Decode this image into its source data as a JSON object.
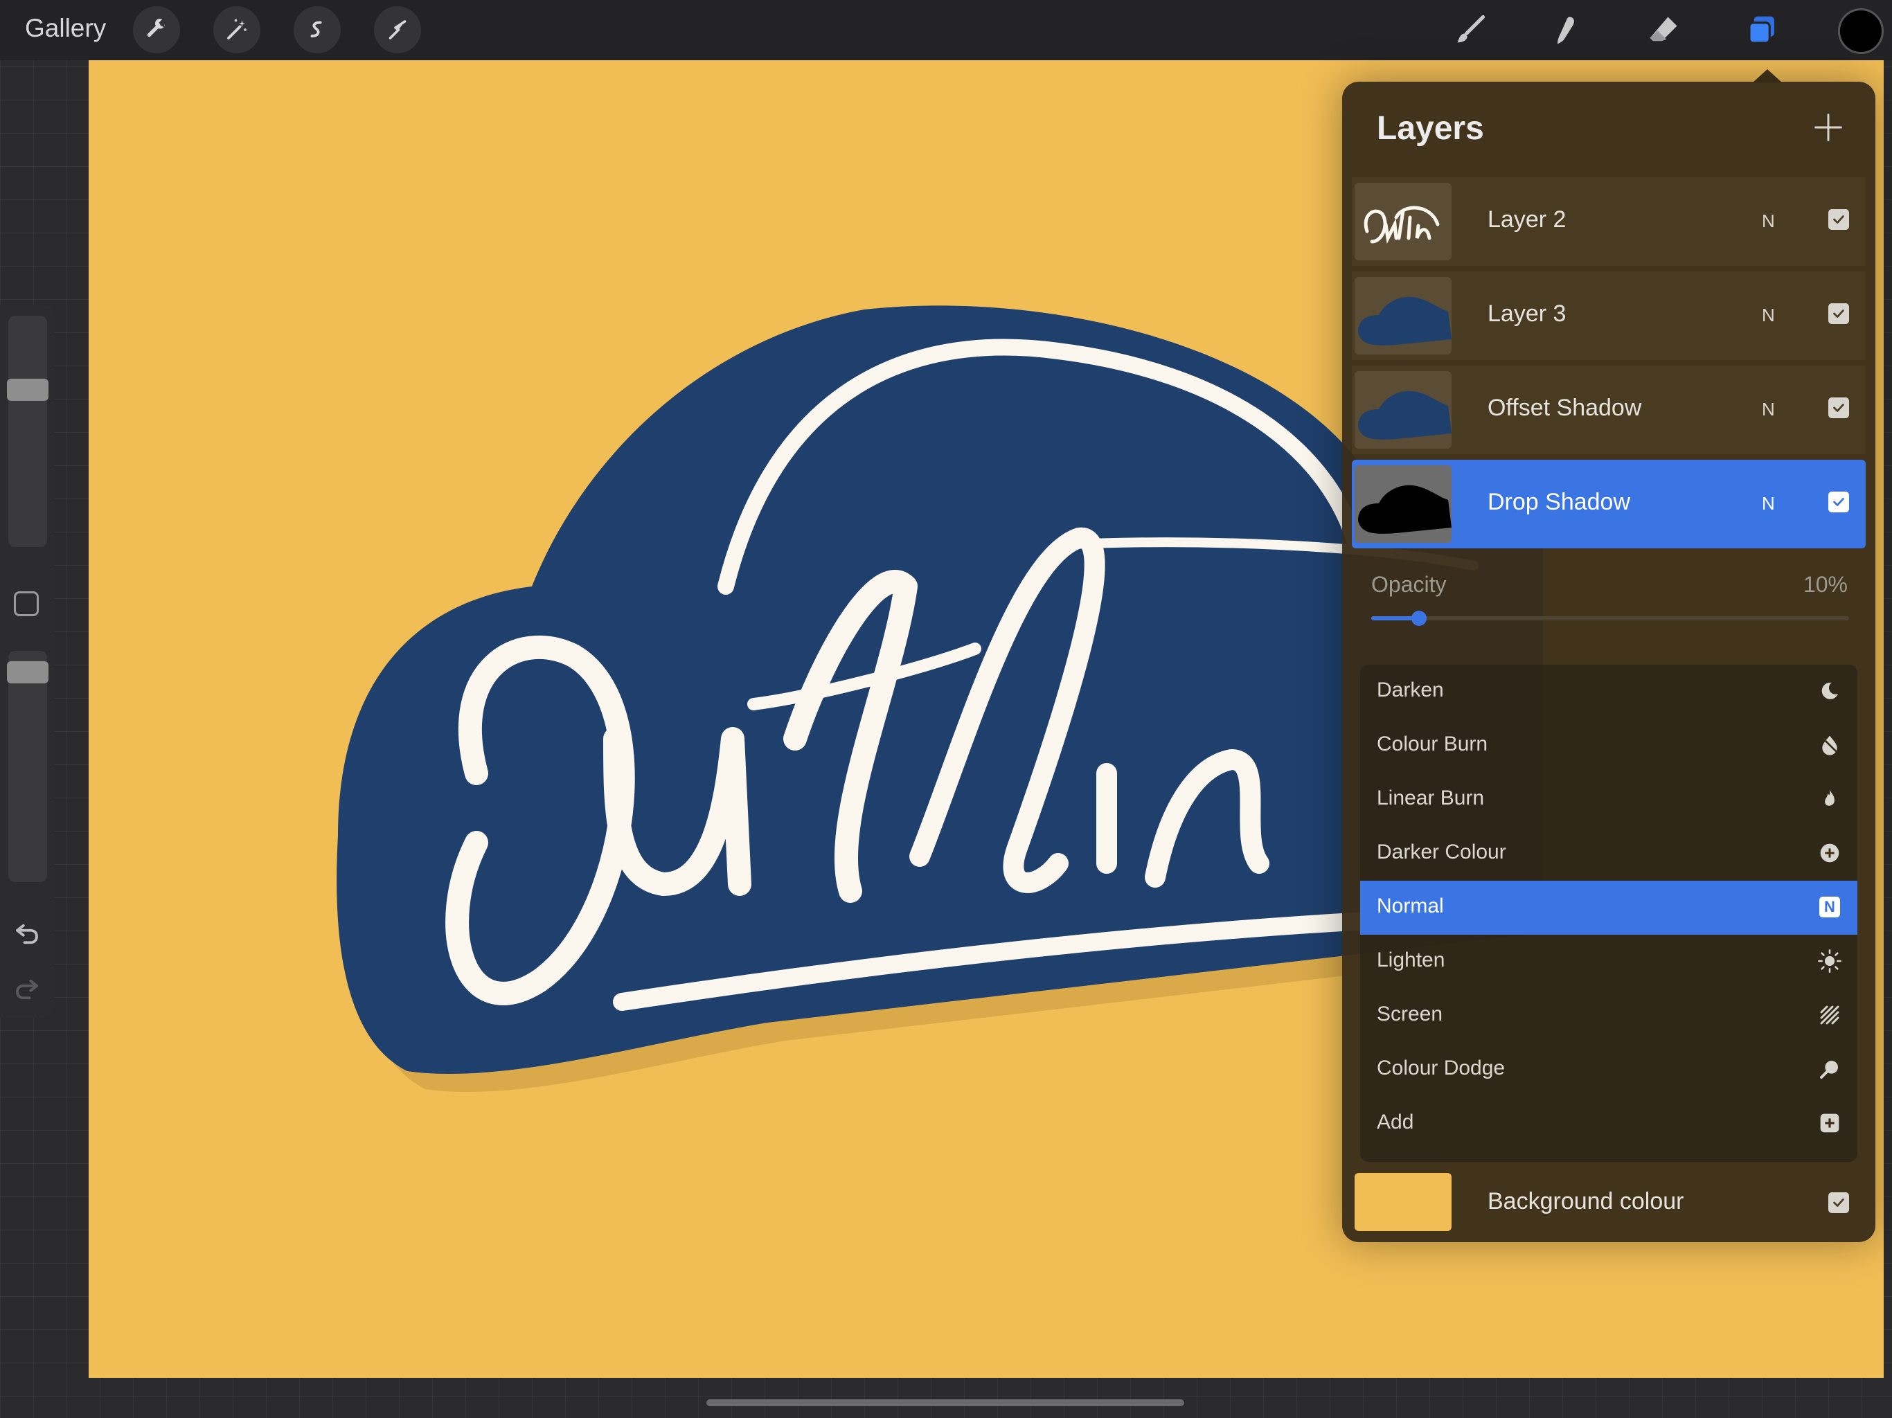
{
  "topbar": {
    "gallery_label": "Gallery",
    "left_tools": [
      "wrench-icon",
      "magic-wand-icon",
      "selection-icon",
      "transform-arrow-icon"
    ],
    "right_tools": [
      "brush-icon",
      "smudge-icon",
      "eraser-icon",
      "layers-icon"
    ],
    "active_color": "#000000",
    "active_tool": "layers"
  },
  "sidebar": {
    "brush_size_level": 0.7,
    "brush_opacity_level": 0.95,
    "modify_button_icon": "square-modify-icon",
    "undo_icon": "undo-icon",
    "redo_icon": "redo-icon"
  },
  "canvas": {
    "background_color": "#f1bd55",
    "artwork_badge_color": "#1f3f6c",
    "artwork_lettering_color": "#fbf7ee"
  },
  "layers": {
    "title": "Layers",
    "items": [
      {
        "name": "Layer 2",
        "mode": "N",
        "visible": true,
        "selected": false,
        "thumb": "lettering"
      },
      {
        "name": "Layer 3",
        "mode": "N",
        "visible": true,
        "selected": false,
        "thumb": "blue-shape"
      },
      {
        "name": "Offset Shadow",
        "mode": "N",
        "visible": true,
        "selected": false,
        "thumb": "blue-shape"
      },
      {
        "name": "Drop Shadow",
        "mode": "N",
        "visible": true,
        "selected": true,
        "thumb": "black-shape"
      }
    ],
    "opacity": {
      "label": "Opacity",
      "value_text": "10%",
      "value": 0.1
    },
    "blend_modes": [
      {
        "label": "Darken",
        "icon": "moon-icon",
        "selected": false
      },
      {
        "label": "Colour Burn",
        "icon": "burn-icon",
        "selected": false
      },
      {
        "label": "Linear Burn",
        "icon": "flame-icon",
        "selected": false
      },
      {
        "label": "Darker Colour",
        "icon": "plus-circle-icon",
        "selected": false
      },
      {
        "label": "Normal",
        "icon": "n-badge-icon",
        "selected": true,
        "badge": "N"
      },
      {
        "label": "Lighten",
        "icon": "sun-icon",
        "selected": false
      },
      {
        "label": "Screen",
        "icon": "hatch-icon",
        "selected": false
      },
      {
        "label": "Colour Dodge",
        "icon": "dodge-icon",
        "selected": false
      },
      {
        "label": "Add",
        "icon": "plus-square-icon",
        "selected": false
      }
    ],
    "background": {
      "label": "Background colour",
      "color": "#f1bd55",
      "visible": true
    }
  }
}
